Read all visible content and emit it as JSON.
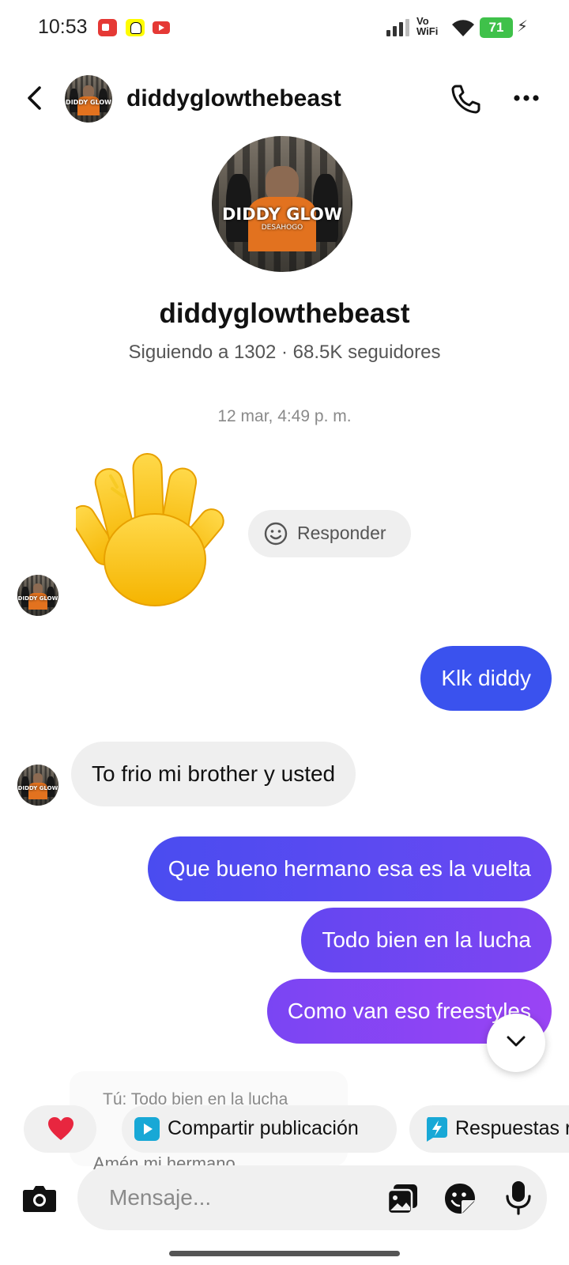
{
  "status_bar": {
    "time": "10:53",
    "network_label": "Vo WiFi",
    "network_line1": "Vo",
    "network_line2": "WiFi",
    "battery": "71",
    "app_icons": [
      "screen-recorder-icon",
      "snapchat-icon",
      "youtube-icon"
    ]
  },
  "header": {
    "username": "diddyglowthebeast"
  },
  "profile": {
    "username": "diddyglowthebeast",
    "stats": "Siguiendo a 1302 · 68.5K seguidores",
    "avatar_title": "DIDDY GLOW",
    "avatar_subtitle": "DESAHOGO"
  },
  "thread": {
    "timestamp": "12 mar, 4:49 p. m.",
    "reply_chip_label": "Responder",
    "messages": [
      {
        "direction": "incoming",
        "type": "emoji",
        "icon": "waving-hand-icon"
      },
      {
        "direction": "outgoing",
        "text": "Klk diddy"
      },
      {
        "direction": "incoming",
        "text": "To frio mi brother y usted"
      },
      {
        "direction": "outgoing",
        "text": "Que bueno hermano esa es la vuelta"
      },
      {
        "direction": "outgoing",
        "text": "Todo bien en la lucha"
      },
      {
        "direction": "outgoing",
        "text": "Como van eso freestyles"
      }
    ]
  },
  "preview": {
    "line1": "Tú: Todo bien en la lucha",
    "line2": "Amén mi hermano"
  },
  "quick_replies": {
    "share_label": "Compartir publicación",
    "quick_label": "Respuestas rápidas"
  },
  "composer": {
    "placeholder": "Mensaje..."
  },
  "colors": {
    "outgoing_start": "#3a52ee",
    "outgoing_end": "#9a44f4",
    "incoming_bg": "#efefef",
    "battery": "#3fc14a"
  }
}
